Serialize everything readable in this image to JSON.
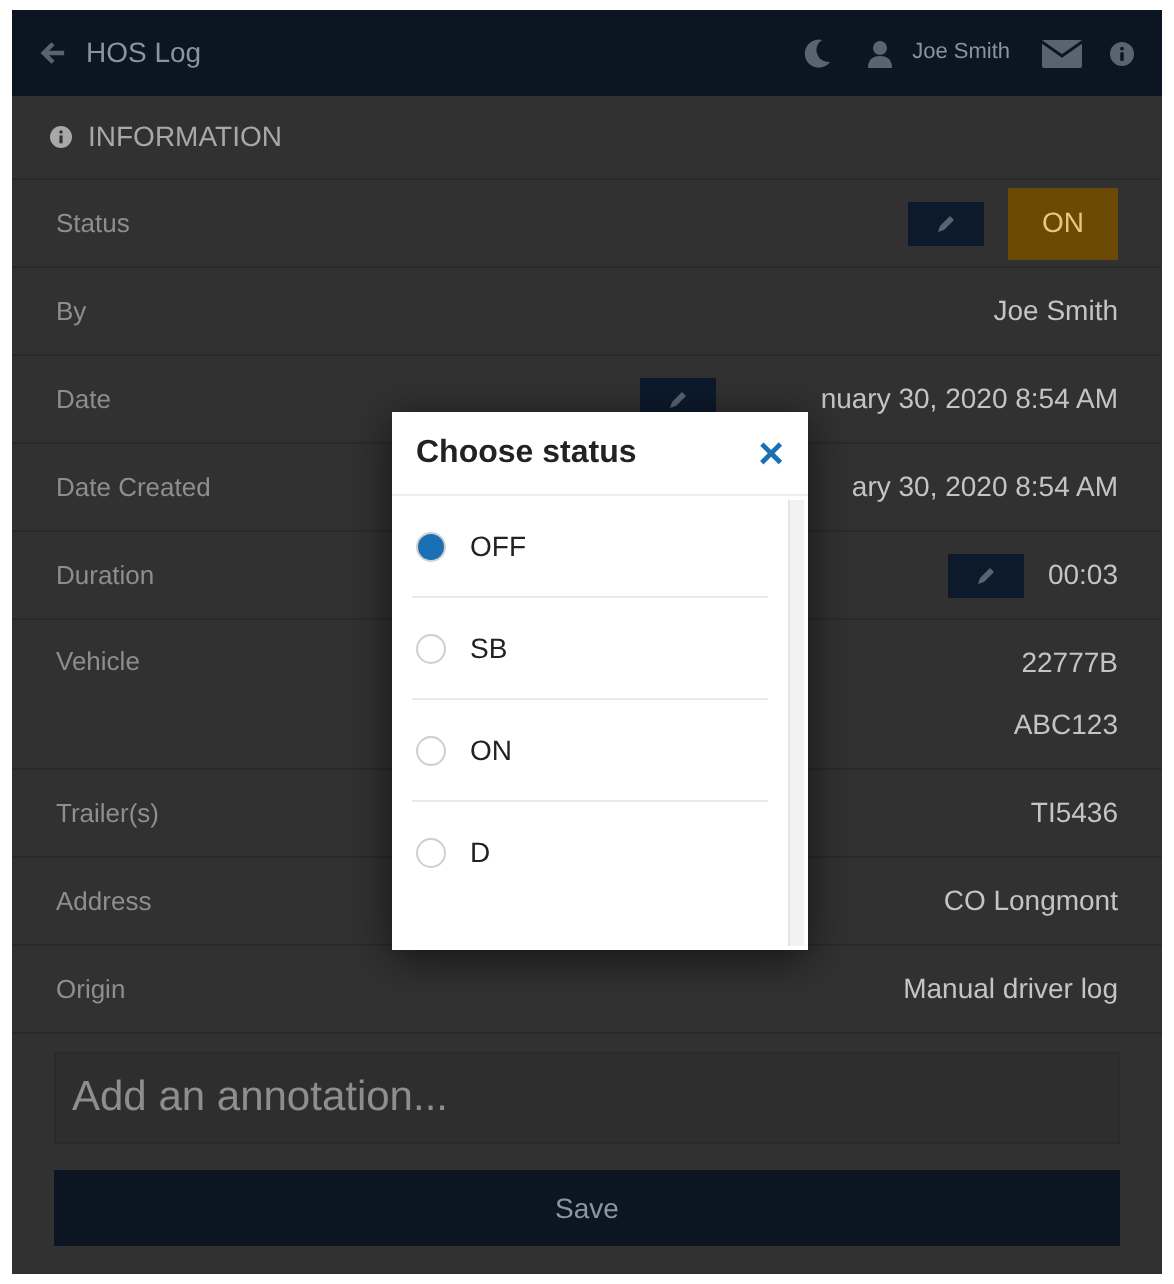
{
  "header": {
    "title": "HOS Log",
    "user": "Joe Smith"
  },
  "section": {
    "title": "INFORMATION"
  },
  "rows": [
    {
      "kind": "status",
      "label": "Status",
      "values": [
        "ON"
      ]
    },
    {
      "kind": "text",
      "label": "By",
      "values": [
        "Joe Smith"
      ]
    },
    {
      "kind": "edit",
      "label": "Date",
      "values": [
        "nuary 30, 2020 8:54 AM"
      ]
    },
    {
      "kind": "text",
      "label": "Date Created",
      "values": [
        "ary 30, 2020 8:54 AM"
      ]
    },
    {
      "kind": "edit",
      "label": "Duration",
      "values": [
        "00:03"
      ]
    },
    {
      "kind": "text",
      "label": "Vehicle",
      "values": [
        "22777B",
        "ABC123"
      ]
    },
    {
      "kind": "text",
      "label": "Trailer(s)",
      "values": [
        "TI5436"
      ]
    },
    {
      "kind": "text",
      "label": "Address",
      "values": [
        "CO Longmont"
      ]
    },
    {
      "kind": "text",
      "label": "Origin",
      "values": [
        "Manual driver log"
      ]
    }
  ],
  "annotation": {
    "placeholder": "Add an annotation..."
  },
  "save_button": "Save",
  "dialog": {
    "title": "Choose status",
    "close": "×",
    "options": [
      {
        "label": "OFF",
        "selected": true
      },
      {
        "label": "SB",
        "selected": false
      },
      {
        "label": "ON",
        "selected": false
      },
      {
        "label": "D",
        "selected": false
      }
    ]
  }
}
